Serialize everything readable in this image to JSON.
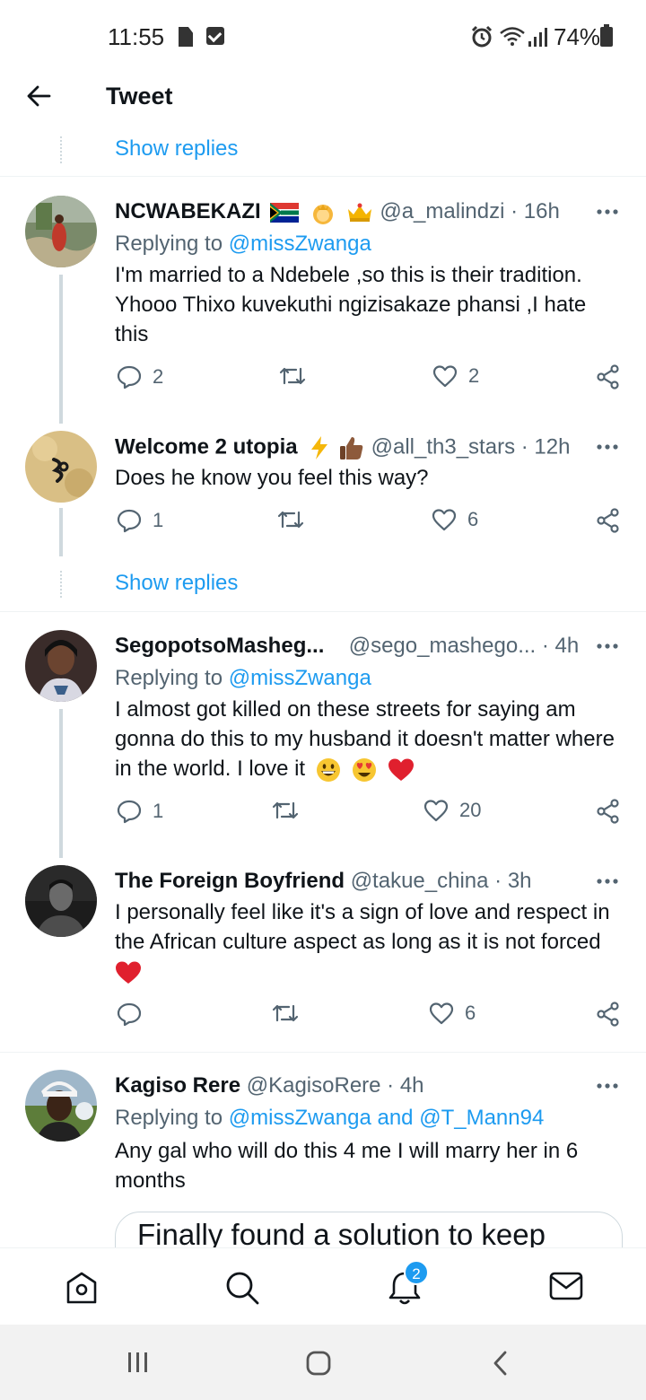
{
  "status_bar": {
    "time": "11:55",
    "battery": "74%"
  },
  "header": {
    "title": "Tweet"
  },
  "show_replies": "Show replies",
  "tweets": [
    {
      "name": "NCWABEKAZI",
      "handle": "@a_malindzi",
      "time": "· 16h",
      "replying_prefix": "Replying to ",
      "replying_to": "@missZwanga",
      "text": "I'm married to a Ndebele ,so this is their tradition. Yhooo Thixo kuvekuthi ngizisakaze phansi ,I hate this",
      "replies": "2",
      "retweets": "",
      "likes": "2"
    },
    {
      "name": "Welcome 2 utopia",
      "handle": "@all_th3_stars",
      "time": "· 12h",
      "text": "Does he know you feel this way?",
      "replies": "1",
      "retweets": "",
      "likes": "6"
    },
    {
      "name": "SegopotsoMasheg...",
      "handle": "@sego_mashego...",
      "time": "· 4h",
      "replying_prefix": "Replying to ",
      "replying_to": "@missZwanga",
      "text": "I almost got killed on these streets for saying am gonna do this to my husband it doesn't matter where in the world. I love it",
      "replies": "1",
      "retweets": "",
      "likes": "20"
    },
    {
      "name": "The Foreign Boyfriend",
      "handle": "@takue_china",
      "time": "· 3h",
      "text": "I personally feel like it's a sign of love and respect in the African culture aspect as long as it is not forced",
      "replies": "",
      "retweets": "",
      "likes": "6"
    },
    {
      "name": "Kagiso Rere",
      "handle": "@KagisoRere",
      "time": "· 4h",
      "replying_prefix": "Replying to ",
      "replying_to": "@missZwanga and @T_Mann94",
      "text": "Any gal who will do this 4 me I will marry her in 6 months"
    }
  ],
  "card": {
    "text": "Finally found a solution to keep"
  },
  "bottom_nav": {
    "notifications_badge": "2"
  },
  "colors": {
    "link": "#1d9bf0",
    "secondary": "#536471",
    "heart": "#e0245e"
  },
  "icons": [
    "back-arrow-icon",
    "reply-icon",
    "retweet-icon",
    "like-icon",
    "share-icon",
    "more-icon",
    "home-icon",
    "search-icon",
    "notifications-icon",
    "messages-icon"
  ]
}
